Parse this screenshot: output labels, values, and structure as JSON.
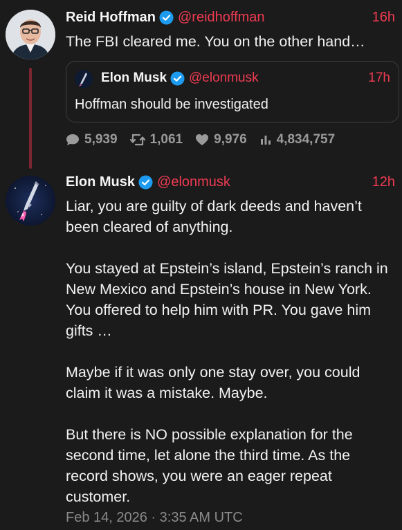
{
  "reply_to": {
    "author_name": "Reid Hoffman",
    "author_handle": "@reidhoffman",
    "time": "16h",
    "text": "The FBI cleared me. You on the other hand…",
    "quoted": {
      "author_name": "Elon Musk",
      "author_handle": "@elonmusk",
      "time": "17h",
      "text": "Hoffman should be investigated"
    },
    "stats": {
      "replies": "5,939",
      "reposts": "1,061",
      "likes": "9,976",
      "views": "4,834,757"
    }
  },
  "tweet": {
    "author_name": "Elon Musk",
    "author_handle": "@elonmusk",
    "time": "12h",
    "paragraphs": [
      "Liar, you are guilty of dark deeds and haven’t been cleared of anything.",
      "You stayed at Epstein’s island, Epstein’s ranch in New Mexico and Epstein’s house in New York. You offered to help him with PR. You gave him gifts …",
      "Maybe if it was only one stay over, you could claim it was a mistake. Maybe.",
      "But there is NO possible explanation for the second time, let alone the third time. As the record shows, you were an eager repeat customer."
    ],
    "timestamp": "Feb 14, 2026 · 3:35 AM UTC"
  },
  "icons": {
    "verified": "verified-badge-icon",
    "reply": "speech-bubble-icon",
    "repost": "repost-arrows-icon",
    "like": "heart-icon",
    "views": "bar-chart-icon"
  },
  "colors": {
    "background": "#1b1b1b",
    "accent": "#ef3b52",
    "verified": "#1d9bf0",
    "thread_line": "#7a2530",
    "muted": "#9a9a9a"
  }
}
